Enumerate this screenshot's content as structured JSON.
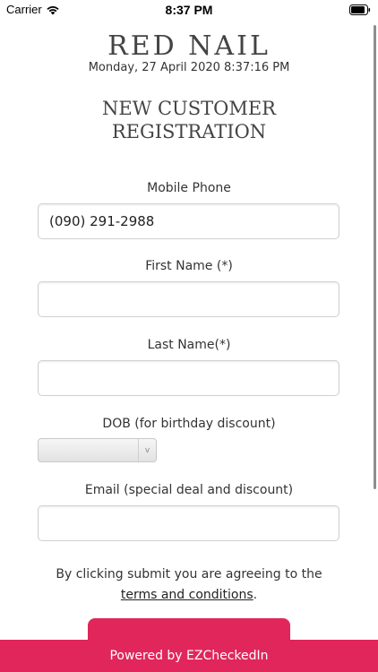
{
  "status_bar": {
    "carrier": "Carrier",
    "time": "8:37 PM",
    "wifi_icon": "wifi-icon",
    "battery_icon": "battery-icon"
  },
  "header": {
    "brand": "RED NAIL",
    "datetime": "Monday, 27 April 2020 8:37:16 PM",
    "title": "NEW CUSTOMER REGISTRATION"
  },
  "form": {
    "mobile_phone": {
      "label": "Mobile Phone",
      "value": "(090) 291-2988"
    },
    "first_name": {
      "label": "First Name (*)",
      "value": ""
    },
    "last_name": {
      "label": "Last Name(*)",
      "value": ""
    },
    "dob": {
      "label": "DOB (for birthday discount)",
      "value": "",
      "arrow": "v"
    },
    "email": {
      "label": "Email (special deal and discount)",
      "value": ""
    }
  },
  "consent": {
    "text": "By clicking submit you are agreeing to the",
    "link": "terms and conditions",
    "suffix": "."
  },
  "footer": {
    "text": "Powered by EZCheckedIn"
  },
  "colors": {
    "accent": "#e0265a"
  }
}
